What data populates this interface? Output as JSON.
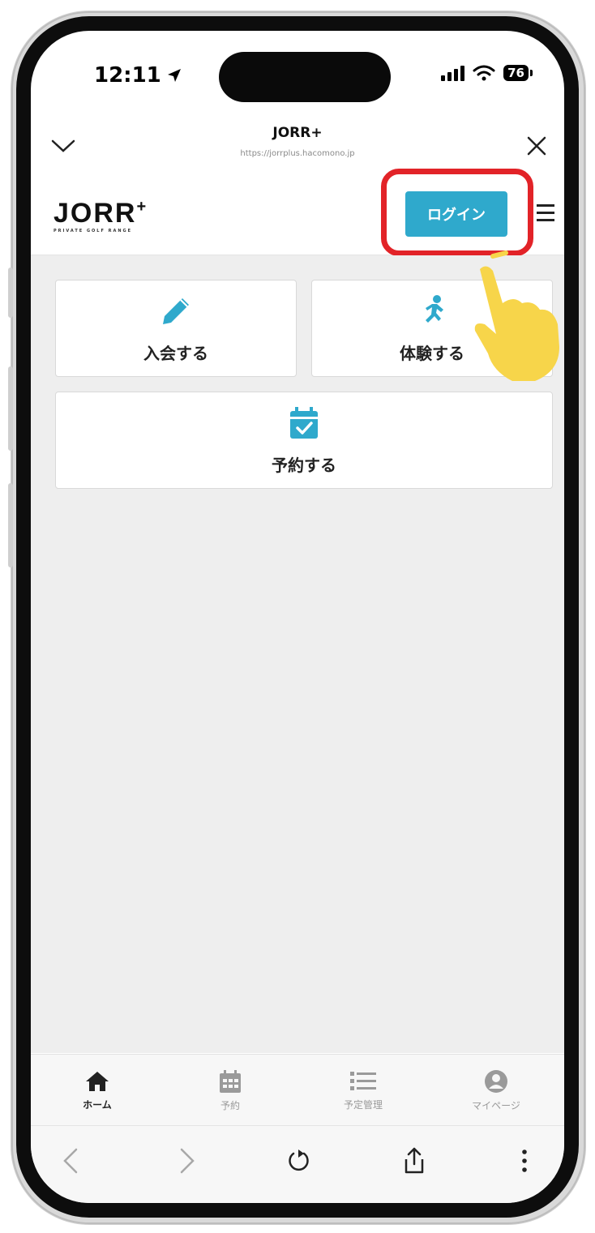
{
  "status_bar": {
    "time": "12:11",
    "battery": "76"
  },
  "browser": {
    "title": "JORR+",
    "url": "https://jorrplus.hacomono.jp"
  },
  "site": {
    "logo_text": "JORR",
    "logo_plus": "+",
    "logo_subtitle": "PRIVATE GOLF RANGE",
    "login_label": "ログイン"
  },
  "cards": {
    "join": {
      "label": "入会する",
      "icon": "pencil-icon"
    },
    "trial": {
      "label": "体験する",
      "icon": "running-person-icon"
    },
    "reserve": {
      "label": "予約する",
      "icon": "calendar-check-icon"
    }
  },
  "tabs": [
    {
      "label": "ホーム",
      "icon": "home-icon",
      "active": true
    },
    {
      "label": "予約",
      "icon": "calendar-icon",
      "active": false
    },
    {
      "label": "予定管理",
      "icon": "list-icon",
      "active": false
    },
    {
      "label": "マイページ",
      "icon": "user-circle-icon",
      "active": false
    }
  ],
  "colors": {
    "accent": "#2fa9cc",
    "highlight": "#e22328",
    "hand": "#f7d54a"
  }
}
